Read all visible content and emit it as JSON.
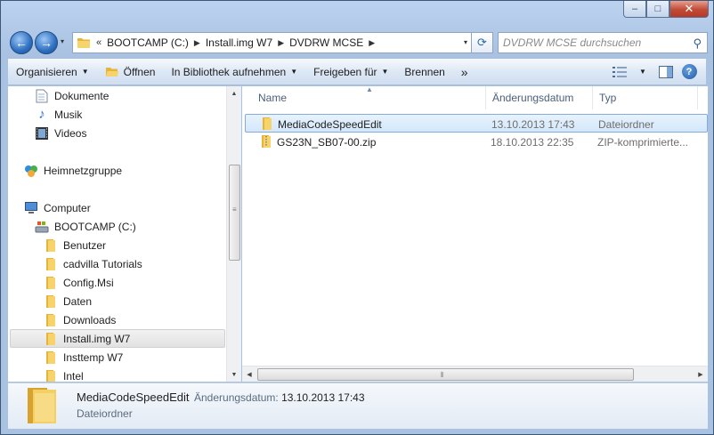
{
  "window": {
    "controls": {
      "minimize": "–",
      "maximize": "□",
      "close": "✕"
    }
  },
  "nav": {
    "back_icon": "←",
    "forward_icon": "→",
    "history_dropdown": "▾",
    "overflow": "«",
    "breadcrumbs": [
      "BOOTCAMP (C:)",
      "Install.img W7",
      "DVDRW MCSE"
    ],
    "address_dropdown": "▾",
    "refresh_icon": "⟳",
    "search_placeholder": "DVDRW MCSE durchsuchen",
    "search_icon": "⚲"
  },
  "toolbar": {
    "organize": "Organisieren",
    "open": "Öffnen",
    "library": "In Bibliothek aufnehmen",
    "share": "Freigeben für",
    "burn": "Brennen",
    "more": "»",
    "help": "?"
  },
  "tree": {
    "items": [
      {
        "label": "Dokumente",
        "icon": "document-icon"
      },
      {
        "label": "Musik",
        "icon": "music-icon"
      },
      {
        "label": "Videos",
        "icon": "video-icon"
      },
      {
        "label": "Heimnetzgruppe",
        "icon": "homegroup-icon"
      },
      {
        "label": "Computer",
        "icon": "computer-icon"
      },
      {
        "label": "BOOTCAMP (C:)",
        "icon": "drive-icon"
      },
      {
        "label": "Benutzer",
        "icon": "folder-icon"
      },
      {
        "label": "cadvilla Tutorials",
        "icon": "folder-icon"
      },
      {
        "label": "Config.Msi",
        "icon": "folder-icon"
      },
      {
        "label": "Daten",
        "icon": "folder-icon"
      },
      {
        "label": "Downloads",
        "icon": "folder-icon"
      },
      {
        "label": "Install.img W7",
        "icon": "folder-icon"
      },
      {
        "label": "Insttemp W7",
        "icon": "folder-icon"
      },
      {
        "label": "Intel",
        "icon": "folder-icon"
      }
    ],
    "scroll_up": "▲",
    "scroll_down": "▼"
  },
  "columns": {
    "name": "Name",
    "date": "Änderungsdatum",
    "type": "Typ",
    "sort_indicator": "▲"
  },
  "files": [
    {
      "name": "MediaCodeSpeedEdit",
      "date": "13.10.2013 17:43",
      "type": "Dateiordner",
      "icon": "folder-icon"
    },
    {
      "name": "GS23N_SB07-00.zip",
      "date": "18.10.2013 22:35",
      "type": "ZIP-komprimierte...",
      "icon": "zip-folder-icon"
    }
  ],
  "hscroll": {
    "left": "◀",
    "right": "▶"
  },
  "details": {
    "name": "MediaCodeSpeedEdit",
    "date_label": "Änderungsdatum:",
    "date_value": "13.10.2013 17:43",
    "type": "Dateiordner"
  },
  "colors": {
    "folder": "#f2c94c",
    "selection": "#d3e7fb",
    "accent": "#1d5aa6"
  }
}
